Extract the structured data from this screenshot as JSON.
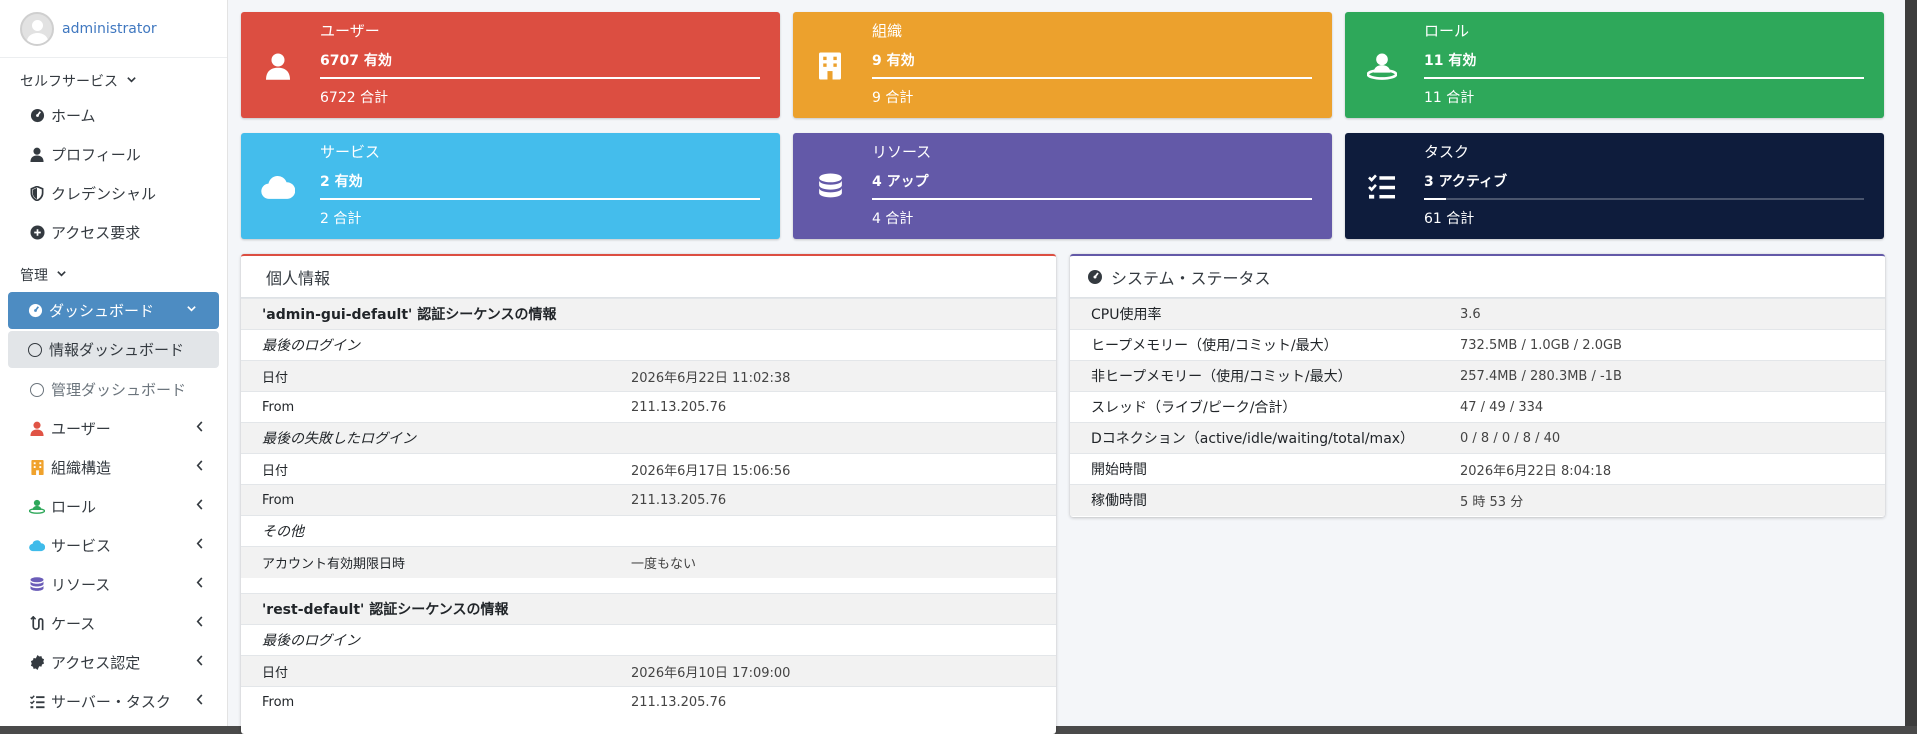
{
  "sidebar": {
    "user": "administrator",
    "selfservice_header": "セルフサービス",
    "self_items": [
      {
        "label": "ホーム",
        "icon": "dashboard-gauge-icon"
      },
      {
        "label": "プロフィール",
        "icon": "user-icon"
      },
      {
        "label": "クレデンシャル",
        "icon": "shield-icon"
      },
      {
        "label": "アクセス要求",
        "icon": "plus-circle-icon"
      }
    ],
    "admin_header": "管理",
    "dashboard": "ダッシュボード",
    "dashboard_sub": [
      "情報ダッシュボード",
      "管理ダッシュボード"
    ],
    "admin_items": [
      {
        "label": "ユーザー",
        "icon": "user-icon",
        "color": "#e05345"
      },
      {
        "label": "組織構造",
        "icon": "building-icon",
        "color": "#f0a22c"
      },
      {
        "label": "ロール",
        "icon": "role-icon",
        "color": "#2ea85a"
      },
      {
        "label": "サービス",
        "icon": "cloud-icon",
        "color": "#3fbbea"
      },
      {
        "label": "リソース",
        "icon": "database-icon",
        "color": "#6b5db8"
      },
      {
        "label": "ケース",
        "icon": "case-flow-icon",
        "color": "#343a40"
      },
      {
        "label": "アクセス認定",
        "icon": "certificate-icon",
        "color": "#343a40"
      },
      {
        "label": "サーバー・タスク",
        "icon": "task-list-icon",
        "color": "#343a40"
      }
    ]
  },
  "boxes": [
    {
      "title": "ユーザー",
      "num": "6707 有効",
      "total": "6722 合計",
      "color": "#dc4e41",
      "icon": "user-icon",
      "fill": 0.998
    },
    {
      "title": "組織",
      "num": "9 有効",
      "total": "9 合計",
      "color": "#eca12d",
      "icon": "building-icon",
      "fill": 1.0
    },
    {
      "title": "ロール",
      "num": "11 有効",
      "total": "11 合計",
      "color": "#2ea85a",
      "icon": "role-icon",
      "fill": 1.0
    },
    {
      "title": "サービス",
      "num": "2 有効",
      "total": "2 合計",
      "color": "#44bdec",
      "icon": "cloud-icon",
      "fill": 1.0
    },
    {
      "title": "リソース",
      "num": "4 アップ",
      "total": "4 合計",
      "color": "#6359a8",
      "icon": "database-icon",
      "fill": 1.0
    },
    {
      "title": "タスク",
      "num": "3 アクティブ",
      "total": "61 合計",
      "color": "#0e1c3c",
      "icon": "task-list-icon",
      "fill": 0.049
    }
  ],
  "personal": {
    "title": "個人情報",
    "accent": "#dc4e41",
    "rows": [
      {
        "kind": "section",
        "k": "'admin-gui-default' 認証シーケンスの情報"
      },
      {
        "kind": "italic",
        "k": "最後のログイン"
      },
      {
        "kind": "kv",
        "k": "日付",
        "v": "2026年6月22日 11:02:38"
      },
      {
        "kind": "kv",
        "k": "From",
        "v": "211.13.205.76"
      },
      {
        "kind": "italic",
        "k": "最後の失敗したログイン"
      },
      {
        "kind": "kv",
        "k": "日付",
        "v": "2026年6月17日 15:06:56"
      },
      {
        "kind": "kv",
        "k": "From",
        "v": "211.13.205.76"
      },
      {
        "kind": "italic",
        "k": "その他"
      },
      {
        "kind": "kv",
        "k": "アカウント有効期限日時",
        "v": "一度もない"
      },
      {
        "kind": "spacer"
      },
      {
        "kind": "section",
        "k": "'rest-default' 認証シーケンスの情報"
      },
      {
        "kind": "italic",
        "k": "最後のログイン"
      },
      {
        "kind": "kv",
        "k": "日付",
        "v": "2026年6月10日 17:09:00"
      },
      {
        "kind": "kv",
        "k": "From",
        "v": "211.13.205.76"
      }
    ]
  },
  "system": {
    "title": "システム・ステータス",
    "accent": "#6359a8",
    "rows": [
      {
        "k": "CPU使用率",
        "v": "3.6"
      },
      {
        "k": "ヒープメモリー（使用/コミット/最大）",
        "v": "732.5MB / 1.0GB / 2.0GB"
      },
      {
        "k": "非ヒープメモリー（使用/コミット/最大）",
        "v": "257.4MB / 280.3MB / -1B"
      },
      {
        "k": "スレッド（ライブ/ピーク/合計）",
        "v": "47 / 49 / 334"
      },
      {
        "k": "Dコネクション（active/idle/waiting/total/max）",
        "v": "0 / 8 / 0 / 8 / 40"
      },
      {
        "k": "開始時間",
        "v": "2026年6月22日 8:04:18"
      },
      {
        "k": "稼働時間",
        "v": "5 時 53 分"
      }
    ]
  }
}
